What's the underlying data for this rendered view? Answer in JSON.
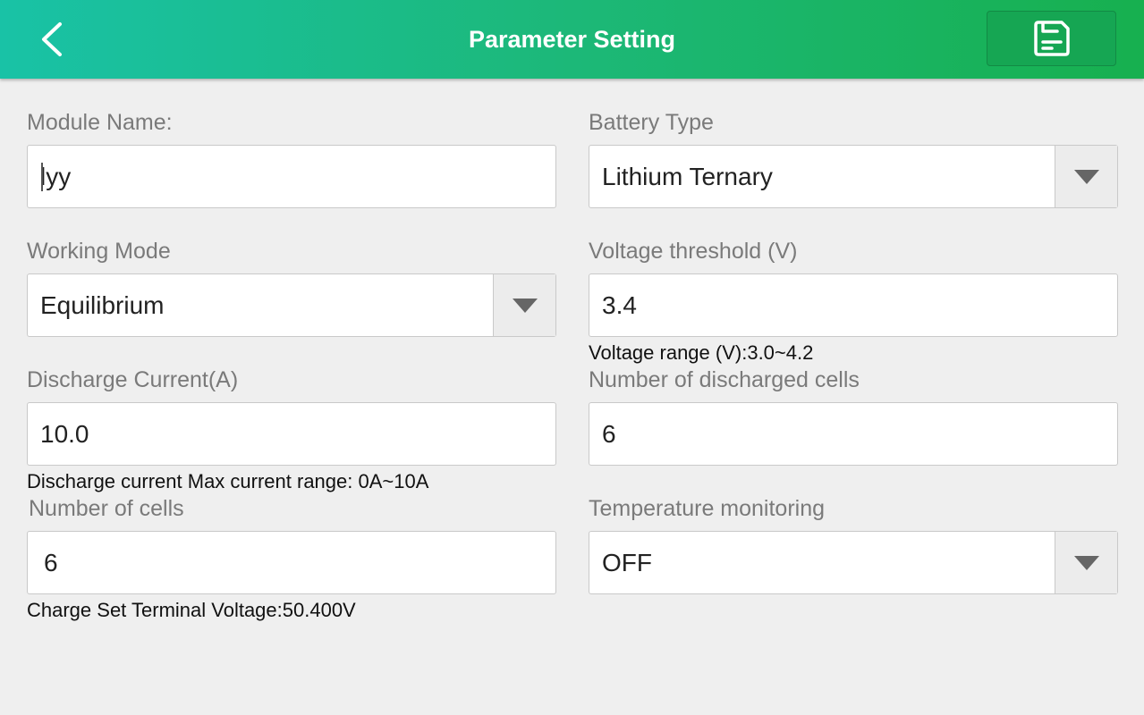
{
  "header": {
    "title": "Parameter Setting",
    "back_icon": "chevron-left-icon",
    "save_icon": "save-document-icon"
  },
  "fields": {
    "module_name": {
      "label": "Module Name:",
      "value": "lyy"
    },
    "battery_type": {
      "label": "Battery Type",
      "value": "Lithium Ternary"
    },
    "working_mode": {
      "label": "Working Mode",
      "value": "Equilibrium"
    },
    "voltage_threshold": {
      "label": "Voltage threshold (V)",
      "value": "3.4",
      "hint": "Voltage range (V):3.0~4.2"
    },
    "discharge_current": {
      "label": "Discharge Current(A)",
      "value": "10.0",
      "hint": "Discharge current Max current range: 0A~10A"
    },
    "discharged_cells": {
      "label": "Number of discharged cells",
      "value": "6"
    },
    "number_of_cells": {
      "label": "Number of cells",
      "value": "6",
      "hint": "Charge Set Terminal Voltage:50.400V"
    },
    "temperature_monitoring": {
      "label": "Temperature monitoring",
      "value": "OFF"
    }
  },
  "colors": {
    "header_start": "#19c2a6",
    "header_end": "#17b04f",
    "background": "#efefef"
  }
}
